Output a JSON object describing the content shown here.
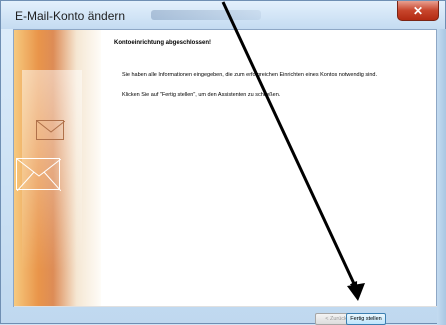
{
  "window": {
    "title": "E-Mail-Konto ändern",
    "close_label": "✕"
  },
  "content": {
    "heading": "Kontoeinrichtung abgeschlossen!",
    "paragraph1": "Sie haben alle Informationen eingegeben, die zum erfolgreichen Einrichten eines Kontos notwendig sind.",
    "paragraph2": "Klicken Sie auf \"Fertig stellen\", um den Assistenten zu schließen."
  },
  "buttons": {
    "back_label": "< Zurück",
    "finish_label": "Fertig stellen"
  },
  "colors": {
    "accent": "#3c7fb1",
    "close": "#c7452c",
    "annotation_arrow": "#000000"
  },
  "icons": {
    "close": "close-icon",
    "wizard_art": "mail-envelope-icon",
    "annotation": "arrow-annotation-icon"
  }
}
